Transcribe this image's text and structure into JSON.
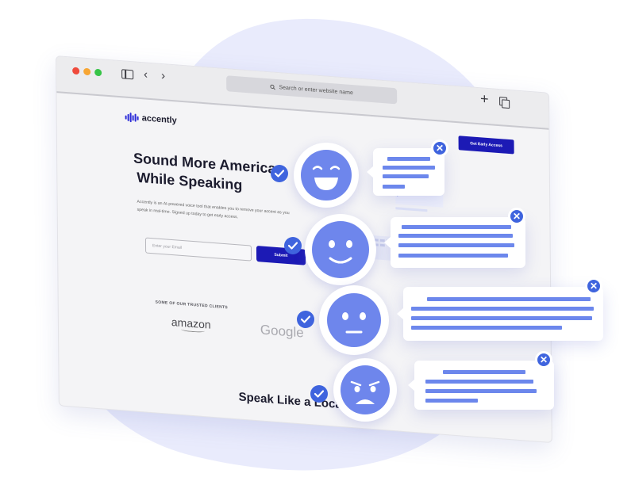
{
  "browser": {
    "url_placeholder": "Search or enter website name",
    "icons": [
      "sidebar-toggle-icon",
      "back-icon",
      "forward-icon",
      "search-icon",
      "new-tab-icon",
      "copy-tab-icon"
    ]
  },
  "site": {
    "logo_text": "accently",
    "cta_label": "Get Early Access",
    "hero_line1": "Sound More American",
    "hero_line2": "While Speaking",
    "hero_description": "Accently is an AI-powered voice tool that enables you to remove your accent as you speak in real-time. Signed up today to get early access.",
    "email_placeholder": "Enter your Email",
    "submit_label": "Submit",
    "clients_label": "SOME OF OUR TRUSTED CLIENTS",
    "clients": [
      "amazon",
      "Google"
    ],
    "section_title_partial": "Speak Like a Local"
  },
  "cards": [
    {
      "mood": "laughing",
      "close_symbol": "✕"
    },
    {
      "mood": "smiling",
      "close_symbol": "✕"
    },
    {
      "mood": "neutral",
      "close_symbol": "✕"
    },
    {
      "mood": "angry",
      "close_symbol": "✕"
    }
  ],
  "colors": {
    "accent": "#1c1ab5",
    "emoji_blue": "#6e86ec",
    "bar_blue": "#6c87ec",
    "badge_blue": "#3f64de",
    "blob": "#e9ebfc"
  }
}
